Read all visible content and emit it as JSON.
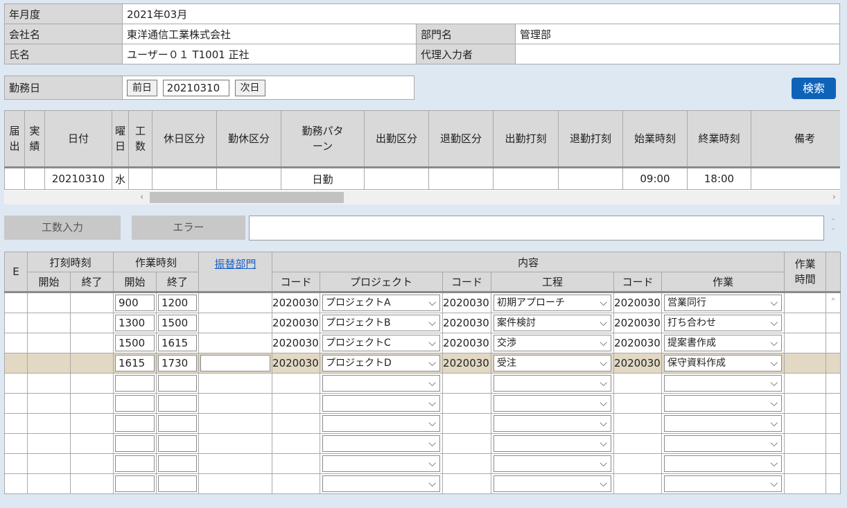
{
  "info": {
    "month_label": "年月度",
    "month_value": "2021年03月",
    "company_label": "会社名",
    "company_value": "東洋通信工業株式会社",
    "dept_label": "部門名",
    "dept_value": "管理部",
    "name_label": "氏名",
    "name_value": "ユーザー０１ T1001 正社",
    "proxy_label": "代理入力者",
    "proxy_value": ""
  },
  "workday": {
    "label": "勤務日",
    "prev": "前日",
    "date": "20210310",
    "next": "次日",
    "search": "検索"
  },
  "attendance": {
    "headers": [
      "届出",
      "実績",
      "日付",
      "曜日",
      "工数",
      "休日区分",
      "勤休区分",
      "勤務パターン",
      "出勤区分",
      "退勤区分",
      "出勤打刻",
      "退勤打刻",
      "始業時刻",
      "終業時刻",
      "備考"
    ],
    "row": {
      "date": "20210310",
      "weekday": "水",
      "pattern": "日勤",
      "start": "09:00",
      "end": "18:00"
    }
  },
  "toolbar": {
    "kosu_button": "工数入力",
    "error_label": "エラー",
    "error_value": ""
  },
  "work": {
    "header": {
      "e": "E",
      "stamp": "打刻時刻",
      "worktime": "作業時刻",
      "transfer": "振替部門",
      "content": "内容",
      "duration": "作業時間",
      "start": "開始",
      "end": "終了",
      "code": "コード",
      "project": "プロジェクト",
      "process": "工程",
      "task": "作業"
    },
    "rows": [
      {
        "start": "900",
        "end": "1200",
        "pcode": "2020030",
        "project": "プロジェクトA",
        "rcode": "2020030",
        "process": "初期アプローチ",
        "tcode": "2020030",
        "task": "営業同行"
      },
      {
        "start": "1300",
        "end": "1500",
        "pcode": "2020030",
        "project": "プロジェクトB",
        "rcode": "2020030",
        "process": "案件検討",
        "tcode": "2020030",
        "task": "打ち合わせ"
      },
      {
        "start": "1500",
        "end": "1615",
        "pcode": "2020030",
        "project": "プロジェクトC",
        "rcode": "2020030",
        "process": "交渉",
        "tcode": "2020030",
        "task": "提案書作成"
      },
      {
        "start": "1615",
        "end": "1730",
        "pcode": "2020030",
        "project": "プロジェクトD",
        "rcode": "2020030",
        "process": "受注",
        "tcode": "2020030",
        "task": "保守資料作成"
      }
    ]
  }
}
